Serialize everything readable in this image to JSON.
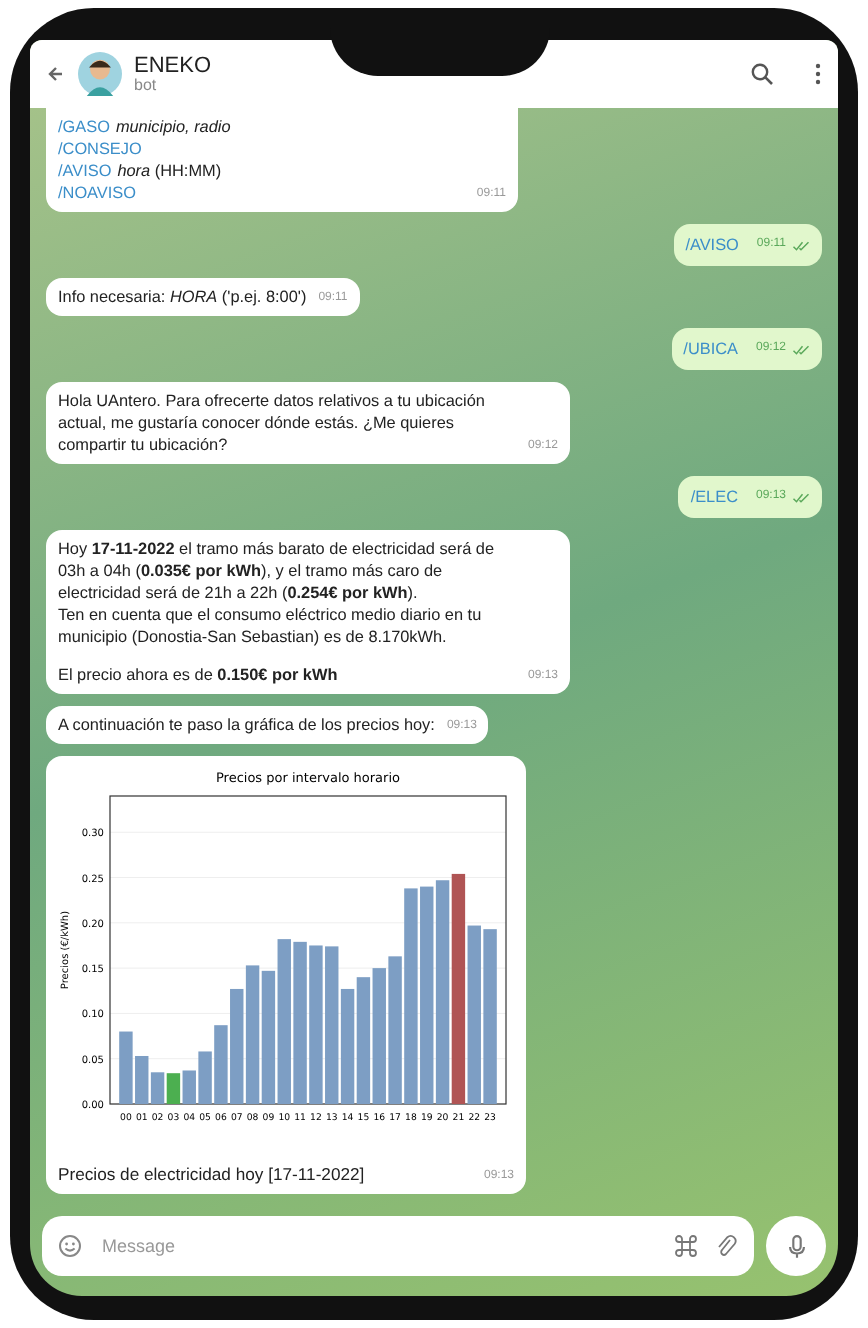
{
  "header": {
    "title": "ENEKO",
    "subtitle": "bot"
  },
  "messages": [
    {
      "kind": "commands",
      "time": "09:11",
      "lines": [
        {
          "command": "/GASO",
          "args": "*municipio, radio*"
        },
        {
          "command": "/CONSEJO"
        },
        {
          "command": "/AVISO",
          "args": "*hora* (HH:MM)"
        },
        {
          "command": "/NOAVISO"
        }
      ]
    },
    {
      "kind": "out",
      "time": "09:11",
      "text": "/AVISO"
    },
    {
      "kind": "in",
      "time": "09:11",
      "paragraphs": [
        "Info necesaria: *HORA* ('p.ej. 8:00')"
      ]
    },
    {
      "kind": "out",
      "time": "09:12",
      "text": "/UBICA"
    },
    {
      "kind": "in",
      "time": "09:12",
      "paragraphs": [
        "Hola UAntero. Para ofrecerte datos relativos a tu ubicación actual, me gustaría conocer dónde estás. ¿Me quieres compartir tu ubicación?"
      ]
    },
    {
      "kind": "out",
      "time": "09:13",
      "text": "/ELEC"
    },
    {
      "kind": "in",
      "time": "09:13",
      "paragraphs": [
        "Hoy **17-11-2022** el tramo más barato de electricidad será de 03h a 04h (**0.035€ por kWh**), y el tramo más caro de electricidad será de 21h a 22h (**0.254€ por kWh**).\nTen en cuenta que el consumo eléctrico medio diario en tu municipio (Donostia-San Sebastian) es de 8.170kWh.",
        "El precio ahora es de **0.150€ por kWh**"
      ]
    },
    {
      "kind": "in",
      "time": "09:13",
      "paragraphs": [
        "A continuación te paso la gráfica de los precios hoy:"
      ]
    },
    {
      "kind": "chart",
      "time": "09:13",
      "caption": "Precios de electricidad hoy [17-11-2022]",
      "chart_data": {
        "type": "bar",
        "title": "Precios por intervalo horario",
        "ylabel": "Precios (€/kWh)",
        "categories": [
          "00",
          "01",
          "02",
          "03",
          "04",
          "05",
          "06",
          "07",
          "08",
          "09",
          "10",
          "11",
          "12",
          "13",
          "14",
          "15",
          "16",
          "17",
          "18",
          "19",
          "20",
          "21",
          "22",
          "23"
        ],
        "series": [
          {
            "color": "#7d9ec4",
            "values": [
              0.08,
              0.053,
              0.035,
              null,
              0.037,
              0.058,
              0.087,
              0.127,
              0.153,
              0.147,
              0.182,
              0.179,
              0.175,
              0.174,
              0.127,
              0.14,
              0.15,
              0.163,
              0.238,
              0.24,
              0.247,
              null,
              0.197,
              0.193
            ]
          },
          {
            "color": "#4caf50",
            "values": [
              null,
              null,
              null,
              0.034,
              null,
              null,
              null,
              null,
              null,
              null,
              null,
              null,
              null,
              null,
              null,
              null,
              null,
              null,
              null,
              null,
              null,
              null,
              null,
              null
            ]
          },
          {
            "color": "#b05454",
            "values": [
              null,
              null,
              null,
              null,
              null,
              null,
              null,
              null,
              null,
              null,
              null,
              null,
              null,
              null,
              null,
              null,
              null,
              null,
              null,
              null,
              null,
              0.254,
              null,
              null
            ]
          }
        ],
        "grid": true,
        "ylim": [
          0,
          0.34
        ],
        "yticks": [
          {
            "value": 0,
            "label": "0.00"
          },
          {
            "value": 0.05,
            "label": "0.05"
          },
          {
            "value": 0.1,
            "label": "0.10"
          },
          {
            "value": 0.15,
            "label": "0.15"
          },
          {
            "value": 0.2,
            "label": "0.20"
          },
          {
            "value": 0.25,
            "label": "0.25"
          },
          {
            "value": 0.3,
            "label": "0.30"
          }
        ]
      }
    }
  ],
  "input": {
    "placeholder": "Message"
  }
}
